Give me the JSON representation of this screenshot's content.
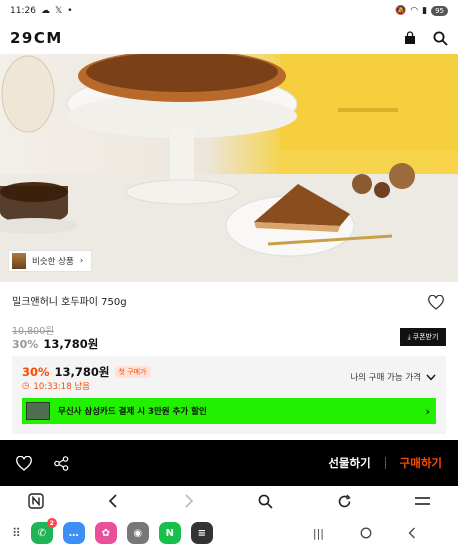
{
  "status_bar": {
    "time": "11:26",
    "battery": "95"
  },
  "header": {
    "logo": "29CM"
  },
  "hero": {
    "similar_chip_label": "비슷한 상품"
  },
  "product": {
    "name": "밀크앤허니 호두파이 750g",
    "original_price": "10,800원",
    "discount_pct": "30%",
    "discount_price": "13,780원",
    "coupon_label": "쿠폰받기"
  },
  "purchase_box": {
    "discount_pct": "30%",
    "price": "13,780원",
    "first_purchase_badge": "첫 구매가",
    "timer": "10:33:18 남음",
    "my_price_label": "나의 구매 가능 가격",
    "promo_text": "무신사 삼성카드 결제 시 3만원 추가 할인"
  },
  "action_bar": {
    "gift_label": "선물하기",
    "buy_label": "구매하기"
  },
  "dock": {
    "phone_badge": "2"
  },
  "colors": {
    "accent": "#ff4800",
    "promo": "#21f000"
  }
}
